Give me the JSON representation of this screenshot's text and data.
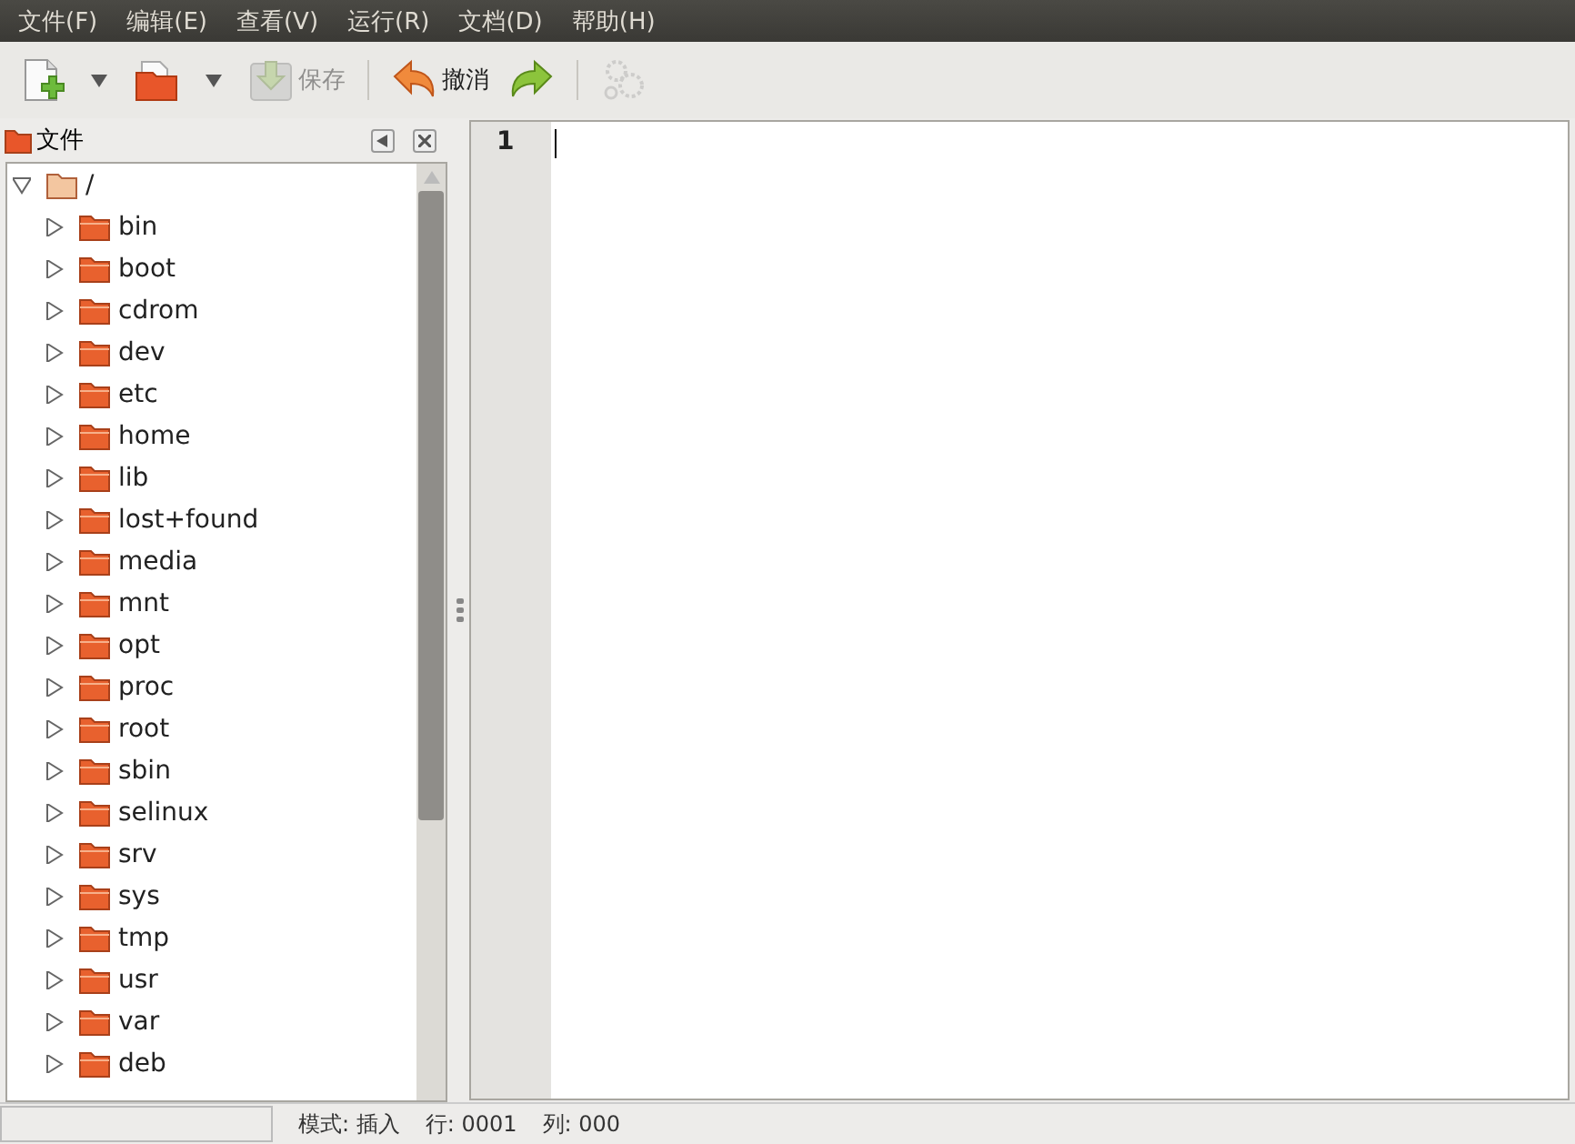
{
  "menu": [
    "文件(F)",
    "编辑(E)",
    "查看(V)",
    "运行(R)",
    "文档(D)",
    "帮助(H)"
  ],
  "toolbar": [
    {
      "kind": "new",
      "disabled": false
    },
    {
      "kind": "dropdown"
    },
    {
      "kind": "open",
      "disabled": false
    },
    {
      "kind": "dropdown"
    },
    {
      "kind": "save",
      "label": "保存",
      "disabled": true
    },
    {
      "kind": "separator"
    },
    {
      "kind": "undo",
      "label": "撤消",
      "disabled": false
    },
    {
      "kind": "redo",
      "disabled": false
    },
    {
      "kind": "separator"
    },
    {
      "kind": "settings",
      "disabled": true
    }
  ],
  "side_panel": {
    "title": "文件",
    "tree": {
      "label": "/",
      "expanded": true,
      "children": [
        {
          "label": "bin",
          "expanded": false
        },
        {
          "label": "boot",
          "expanded": false
        },
        {
          "label": "cdrom",
          "expanded": false
        },
        {
          "label": "dev",
          "expanded": false
        },
        {
          "label": "etc",
          "expanded": false
        },
        {
          "label": "home",
          "expanded": false
        },
        {
          "label": "lib",
          "expanded": false
        },
        {
          "label": "lost+found",
          "expanded": false
        },
        {
          "label": "media",
          "expanded": false
        },
        {
          "label": "mnt",
          "expanded": false
        },
        {
          "label": "opt",
          "expanded": false
        },
        {
          "label": "proc",
          "expanded": false
        },
        {
          "label": "root",
          "expanded": false
        },
        {
          "label": "sbin",
          "expanded": false
        },
        {
          "label": "selinux",
          "expanded": false
        },
        {
          "label": "srv",
          "expanded": false
        },
        {
          "label": "sys",
          "expanded": false
        },
        {
          "label": "tmp",
          "expanded": false
        },
        {
          "label": "usr",
          "expanded": false
        },
        {
          "label": "var",
          "expanded": false
        },
        {
          "label": "deb",
          "expanded": false
        }
      ]
    }
  },
  "editor": {
    "line_numbers": [
      "1"
    ]
  },
  "status_bar": [
    "模式: 插入",
    "行: 0001",
    "列: 000"
  ]
}
